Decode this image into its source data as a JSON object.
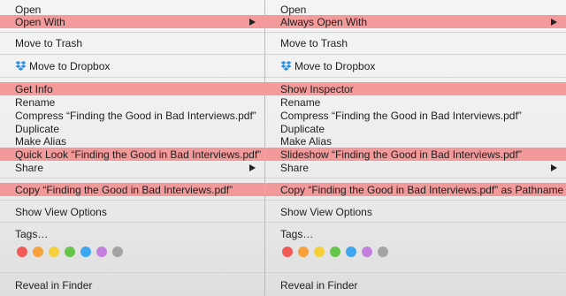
{
  "left_menu": {
    "open": "Open",
    "open_with": "Open With",
    "move_to_trash": "Move to Trash",
    "move_to_dropbox": "Move to Dropbox",
    "get_info": "Get Info",
    "rename": "Rename",
    "compress": "Compress “Finding the Good in Bad Interviews.pdf”",
    "duplicate": "Duplicate",
    "make_alias": "Make Alias",
    "quick_look": "Quick Look “Finding the Good in Bad Interviews.pdf”",
    "share": "Share",
    "copy": "Copy “Finding the Good in Bad Interviews.pdf”",
    "show_view_options": "Show View Options",
    "tags": "Tags…",
    "reveal_in_finder": "Reveal in Finder"
  },
  "right_menu": {
    "open": "Open",
    "always_open_with": "Always Open With",
    "move_to_trash": "Move to Trash",
    "move_to_dropbox": "Move to Dropbox",
    "show_inspector": "Show Inspector",
    "rename": "Rename",
    "compress": "Compress “Finding the Good in Bad Interviews.pdf”",
    "duplicate": "Duplicate",
    "make_alias": "Make Alias",
    "slideshow": "Slideshow “Finding the Good in Bad Interviews.pdf”",
    "share": "Share",
    "copy_as_pathname": "Copy “Finding the Good in Bad Interviews.pdf” as Pathname",
    "show_view_options": "Show View Options",
    "tags": "Tags…",
    "reveal_in_finder": "Reveal in Finder"
  },
  "tag_colors": [
    "#f05a57",
    "#f6a13b",
    "#f5cf3a",
    "#65c64a",
    "#3da7ef",
    "#c47ede",
    "#a3a3a3"
  ],
  "highlight_color": "#f29595",
  "icons": {
    "dropbox": "dropbox-icon",
    "submenu": "submenu-arrow-icon"
  }
}
